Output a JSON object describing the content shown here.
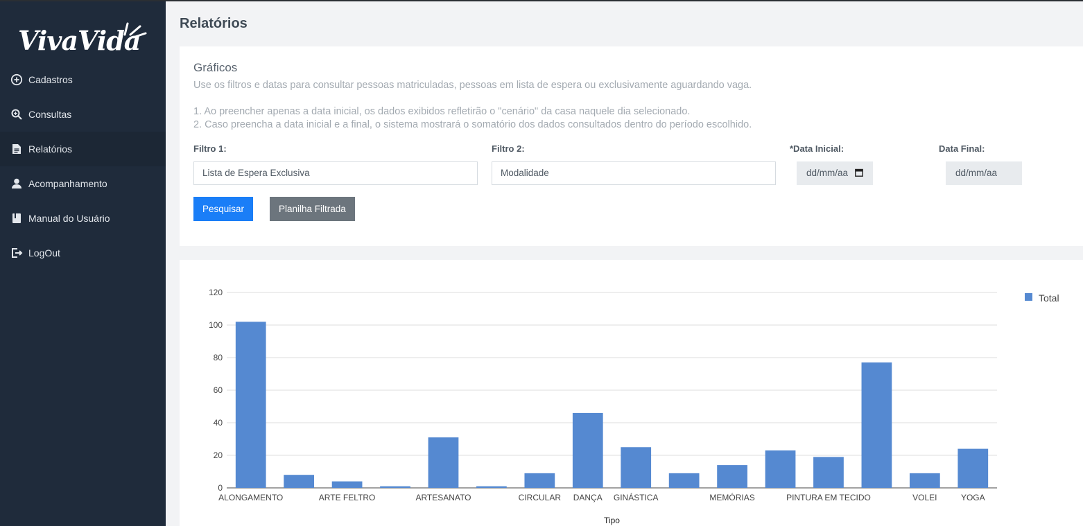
{
  "sidebar": {
    "logo_text": "VivaVida",
    "items": [
      {
        "label": "Cadastros",
        "icon": "plus-circle-icon"
      },
      {
        "label": "Consultas",
        "icon": "search-icon"
      },
      {
        "label": "Relatórios",
        "icon": "document-icon"
      },
      {
        "label": "Acompanhamento",
        "icon": "user-icon"
      },
      {
        "label": "Manual do Usuário",
        "icon": "book-icon"
      },
      {
        "label": "LogOut",
        "icon": "logout-icon"
      }
    ]
  },
  "page": {
    "title": "Relatórios"
  },
  "filters_card": {
    "title": "Gráficos",
    "description": "Use os filtros e datas para consultar pessoas matriculadas, pessoas em lista de espera ou exclusivamente aguardando vaga.",
    "note1": "1. Ao preencher apenas a data inicial, os dados exibidos refletirão o \"cenário\" da casa naquele dia selecionado.",
    "note2": "2. Caso preencha a data inicial e a final, o sistema mostrará o somatório dos dados consultados dentro do período escolhido.",
    "filtro1": {
      "label": "Filtro 1:",
      "value": "Lista de Espera Exclusiva"
    },
    "filtro2": {
      "label": "Filtro 2:",
      "value": "Modalidade"
    },
    "data_inicial": {
      "label": "*Data Inicial:",
      "value": "dd/mm/aa"
    },
    "data_final": {
      "label": "Data Final:",
      "value": "dd/mm/aa"
    },
    "btn_pesquisar": "Pesquisar",
    "btn_planilha": "Planilha Filtrada"
  },
  "chart_data": {
    "type": "bar",
    "categories": [
      "ALONGAMENTO",
      "",
      "ARTE FELTRO",
      "",
      "ARTESANATO",
      "",
      "CIRCULAR",
      "DANÇA",
      "GINÁSTICA",
      "",
      "MEMÓRIAS",
      "",
      "PINTURA EM TECIDO",
      "",
      "VOLEI",
      "YOGA"
    ],
    "series": [
      {
        "name": "Total",
        "values": [
          102,
          8,
          4,
          1,
          31,
          1,
          9,
          46,
          25,
          9,
          14,
          23,
          19,
          77,
          9,
          24
        ]
      }
    ],
    "xlabel": "Tipo",
    "ylabel": "",
    "ylim": [
      0,
      120
    ],
    "yticks": [
      0,
      20,
      40,
      60,
      80,
      100,
      120
    ],
    "color": "#5589d1",
    "grid": true,
    "legend": "top-right"
  }
}
